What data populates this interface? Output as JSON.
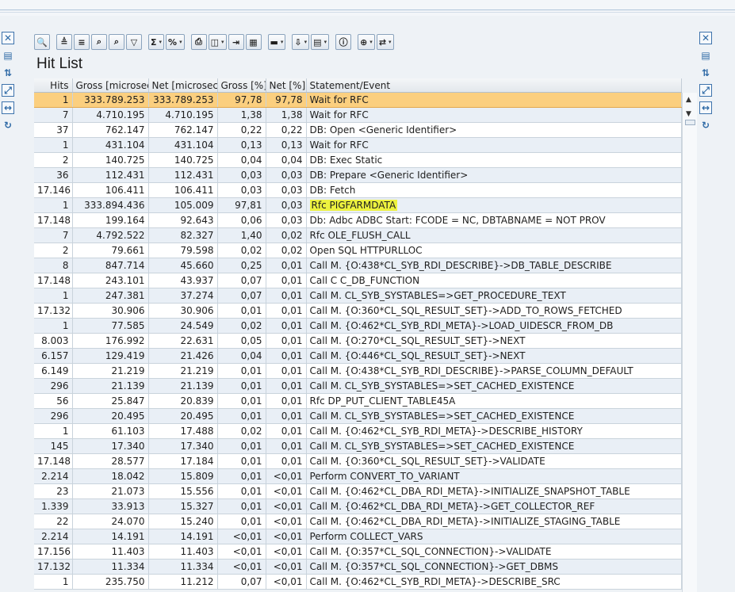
{
  "screen": {
    "title": "Hit List"
  },
  "toolbar": {
    "buttons": [
      {
        "name": "details-button",
        "glyph": "🔍",
        "dropdown": false
      },
      {
        "name": "sort-ascending-button",
        "glyph": "≜",
        "dropdown": false
      },
      {
        "name": "sort-descending-button",
        "glyph": "≡",
        "dropdown": false
      },
      {
        "name": "find-button",
        "glyph": "⌕",
        "dropdown": false
      },
      {
        "name": "find-next-button",
        "glyph": "⌕",
        "dropdown": false
      },
      {
        "name": "filter-button",
        "glyph": "▽",
        "dropdown": false
      },
      {
        "name": "sum-button",
        "glyph": "Σ",
        "dropdown": true
      },
      {
        "name": "subtotal-button",
        "glyph": "%",
        "dropdown": true
      },
      {
        "name": "print-button",
        "glyph": "⎙",
        "dropdown": false
      },
      {
        "name": "views-button",
        "glyph": "◫",
        "dropdown": true
      },
      {
        "name": "export-button",
        "glyph": "⇥",
        "dropdown": false
      },
      {
        "name": "layout-grid-button",
        "glyph": "▦",
        "dropdown": false
      },
      {
        "name": "select-layout-button",
        "glyph": "▬",
        "dropdown": true
      },
      {
        "name": "download-button",
        "glyph": "⇩",
        "dropdown": true
      },
      {
        "name": "change-layout-button",
        "glyph": "▤",
        "dropdown": true
      },
      {
        "name": "information-button",
        "glyph": "ⓘ",
        "dropdown": false
      },
      {
        "name": "zoom-button",
        "glyph": "⊕",
        "dropdown": true
      },
      {
        "name": "navigate-button",
        "glyph": "⇄",
        "dropdown": true
      }
    ]
  },
  "table": {
    "columns": [
      "Hits",
      "Gross [microsec]",
      "Net [microsec]",
      "Gross [%]",
      "Net [%]",
      "Statement/Event"
    ],
    "rows": [
      [
        "1",
        "333.789.253",
        "333.789.253",
        "97,78",
        "97,78",
        "Wait for RFC"
      ],
      [
        "7",
        "4.710.195",
        "4.710.195",
        "1,38",
        "1,38",
        "Wait for RFC"
      ],
      [
        "37",
        "762.147",
        "762.147",
        "0,22",
        "0,22",
        "DB: Open <Generic Identifier>"
      ],
      [
        "1",
        "431.104",
        "431.104",
        "0,13",
        "0,13",
        "Wait for RFC"
      ],
      [
        "2",
        "140.725",
        "140.725",
        "0,04",
        "0,04",
        "DB: Exec Static"
      ],
      [
        "36",
        "112.431",
        "112.431",
        "0,03",
        "0,03",
        "DB: Prepare <Generic Identifier>"
      ],
      [
        "17.146",
        "106.411",
        "106.411",
        "0,03",
        "0,03",
        "DB: Fetch"
      ],
      [
        "1",
        "333.894.436",
        "105.009",
        "97,81",
        "0,03",
        "Rfc PIGFARMDATA"
      ],
      [
        "17.148",
        "199.164",
        "92.643",
        "0,06",
        "0,03",
        "Db: Adbc ADBC Start: FCODE = NC, DBTABNAME = NOT PROV"
      ],
      [
        "7",
        "4.792.522",
        "82.327",
        "1,40",
        "0,02",
        "Rfc OLE_FLUSH_CALL"
      ],
      [
        "2",
        "79.661",
        "79.598",
        "0,02",
        "0,02",
        "Open SQL HTTPURLLOC"
      ],
      [
        "8",
        "847.714",
        "45.660",
        "0,25",
        "0,01",
        "Call M. {O:438*CL_SYB_RDI_DESCRIBE}->DB_TABLE_DESCRIBE"
      ],
      [
        "17.148",
        "243.101",
        "43.937",
        "0,07",
        "0,01",
        "Call C C_DB_FUNCTION"
      ],
      [
        "1",
        "247.381",
        "37.274",
        "0,07",
        "0,01",
        "Call M. CL_SYB_SYSTABLES=>GET_PROCEDURE_TEXT"
      ],
      [
        "17.132",
        "30.906",
        "30.906",
        "0,01",
        "0,01",
        "Call M. {O:360*CL_SQL_RESULT_SET}->ADD_TO_ROWS_FETCHED"
      ],
      [
        "1",
        "77.585",
        "24.549",
        "0,02",
        "0,01",
        "Call M. {O:462*CL_SYB_RDI_META}->LOAD_UIDESCR_FROM_DB"
      ],
      [
        "8.003",
        "176.992",
        "22.631",
        "0,05",
        "0,01",
        "Call M. {O:270*CL_SQL_RESULT_SET}->NEXT"
      ],
      [
        "6.157",
        "129.419",
        "21.426",
        "0,04",
        "0,01",
        "Call M. {O:446*CL_SQL_RESULT_SET}->NEXT"
      ],
      [
        "6.149",
        "21.219",
        "21.219",
        "0,01",
        "0,01",
        "Call M. {O:438*CL_SYB_RDI_DESCRIBE}->PARSE_COLUMN_DEFAULT"
      ],
      [
        "296",
        "21.139",
        "21.139",
        "0,01",
        "0,01",
        "Call M. CL_SYB_SYSTABLES=>SET_CACHED_EXISTENCE"
      ],
      [
        "56",
        "25.847",
        "20.839",
        "0,01",
        "0,01",
        "Rfc DP_PUT_CLIENT_TABLE45A"
      ],
      [
        "296",
        "20.495",
        "20.495",
        "0,01",
        "0,01",
        "Call M. CL_SYB_SYSTABLES=>SET_CACHED_EXISTENCE"
      ],
      [
        "1",
        "61.103",
        "17.488",
        "0,02",
        "0,01",
        "Call M. {O:462*CL_SYB_RDI_META}->DESCRIBE_HISTORY"
      ],
      [
        "145",
        "17.340",
        "17.340",
        "0,01",
        "0,01",
        "Call M. CL_SYB_SYSTABLES=>SET_CACHED_EXISTENCE"
      ],
      [
        "17.148",
        "28.577",
        "17.184",
        "0,01",
        "0,01",
        "Call M. {O:360*CL_SQL_RESULT_SET}->VALIDATE"
      ],
      [
        "2.214",
        "18.042",
        "15.809",
        "0,01",
        "<0,01",
        "Perform CONVERT_TO_VARIANT"
      ],
      [
        "23",
        "21.073",
        "15.556",
        "0,01",
        "<0,01",
        "Call M. {O:462*CL_DBA_RDI_META}->INITIALIZE_SNAPSHOT_TABLE"
      ],
      [
        "1.339",
        "33.913",
        "15.327",
        "0,01",
        "<0,01",
        "Call M. {O:462*CL_DBA_RDI_META}->GET_COLLECTOR_REF"
      ],
      [
        "22",
        "24.070",
        "15.240",
        "0,01",
        "<0,01",
        "Call M. {O:462*CL_DBA_RDI_META}->INITIALIZE_STAGING_TABLE"
      ],
      [
        "2.214",
        "14.191",
        "14.191",
        "<0,01",
        "<0,01",
        "Perform COLLECT_VARS"
      ],
      [
        "17.156",
        "11.403",
        "11.403",
        "<0,01",
        "<0,01",
        "Call M. {O:357*CL_SQL_CONNECTION}->VALIDATE"
      ],
      [
        "17.132",
        "11.334",
        "11.334",
        "<0,01",
        "<0,01",
        "Call M. {O:357*CL_SQL_CONNECTION}->GET_DBMS"
      ],
      [
        "1",
        "235.750",
        "11.212",
        "0,07",
        "<0,01",
        "Call M. {O:462*CL_SYB_RDI_META}->DESCRIBE_SRC"
      ]
    ],
    "selected_row": 0,
    "highlighted_row": 7
  },
  "colors": {
    "selected_row": "#fbcf7f",
    "highlight_marker": "#edf23f",
    "alt_row": "#e9eff6"
  }
}
